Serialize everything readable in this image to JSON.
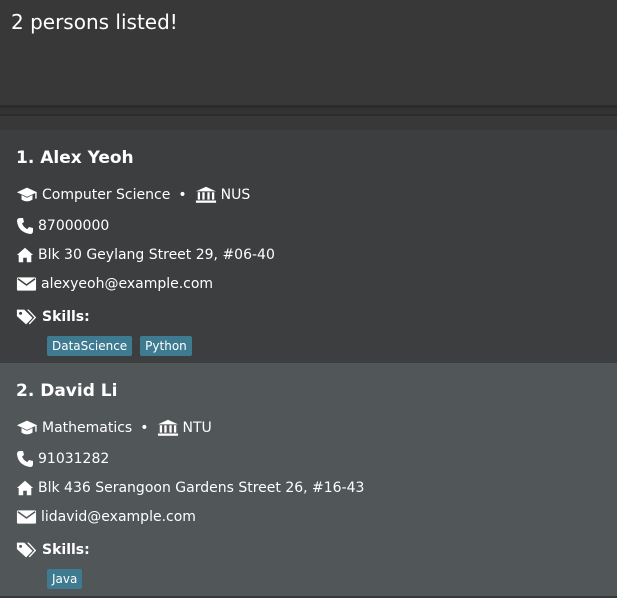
{
  "result": {
    "message": "2 persons listed!"
  },
  "persons": [
    {
      "name": "1. Alex Yeoh",
      "major": "Computer Science",
      "university": "NUS",
      "phone": "87000000",
      "address": "Blk 30 Geylang Street 29, #06-40",
      "email": "alexyeoh@example.com",
      "skills_label": "Skills:",
      "skills": [
        "DataScience",
        "Python"
      ]
    },
    {
      "name": "2. David Li",
      "major": "Mathematics",
      "university": "NTU",
      "phone": "91031282",
      "address": "Blk 436 Serangoon Gardens Street 26, #16-43",
      "email": "lidavid@example.com",
      "skills_label": "Skills:",
      "skills": [
        "Java"
      ]
    }
  ],
  "bullet": "•",
  "icons": {
    "education": "graduation-cap-icon",
    "university": "university-building-icon",
    "phone": "phone-icon",
    "address": "home-icon",
    "email": "envelope-icon",
    "skills": "tags-icon"
  },
  "colors": {
    "background": "#383838",
    "card_odd": "#3c3e3f",
    "card_even": "#515658",
    "tag": "#3e7b91"
  }
}
